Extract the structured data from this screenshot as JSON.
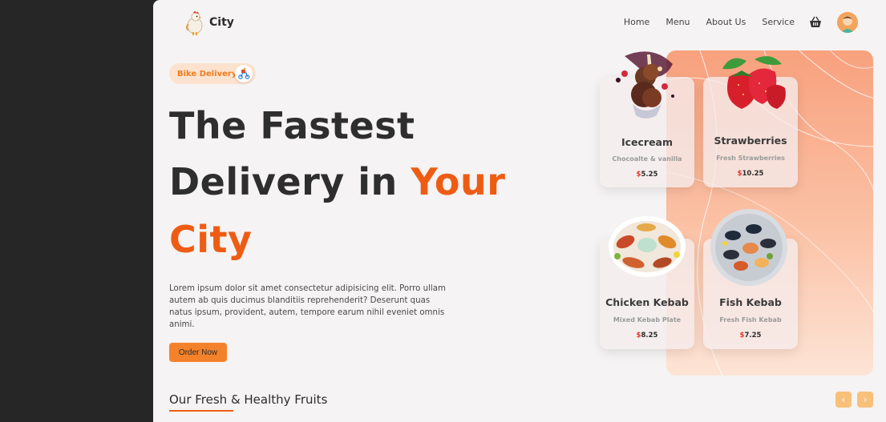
{
  "brand": {
    "name": "City"
  },
  "nav": {
    "items": [
      "Home",
      "Menu",
      "About Us",
      "Service"
    ]
  },
  "badge": {
    "label": "Bike Delivery"
  },
  "hero": {
    "line1": "The Fastest",
    "line2_plain": "Delivery in ",
    "line2_accent": "Your",
    "line3": "City",
    "description": "Lorem ipsum dolor sit amet consectetur adipisicing elit. Porro ullam autem ab quis ducimus blanditiis reprehenderit? Deserunt quas natus ipsum, provident, autem, tempore earum nihil eveniet omnis animi.",
    "cta": "Order Now"
  },
  "section": {
    "title": "Our Fresh & Healthy Fruits"
  },
  "carousel": {
    "prev": "‹",
    "next": "›"
  },
  "cards": [
    {
      "name": "Icecream",
      "subtitle": "Chocoalte & vanilla",
      "currency": "$",
      "price": "5.25"
    },
    {
      "name": "Strawberries",
      "subtitle": "Fresh Strawberries",
      "currency": "$",
      "price": "10.25"
    },
    {
      "name": "Chicken Kebab",
      "subtitle": "Mixed Kebab Plate",
      "currency": "$",
      "price": "8.25"
    },
    {
      "name": "Fish Kebab",
      "subtitle": "Fresh Fish Kebab",
      "currency": "$",
      "price": "7.25"
    }
  ],
  "colors": {
    "accent": "#ee5c13",
    "button": "#f3822a",
    "badge_bg": "#fde3cf",
    "panel": "#f8a17e"
  },
  "icons": [
    "chicken-logo-icon",
    "basket-icon",
    "avatar-icon",
    "scooter-icon",
    "chevron-left-icon",
    "chevron-right-icon"
  ]
}
